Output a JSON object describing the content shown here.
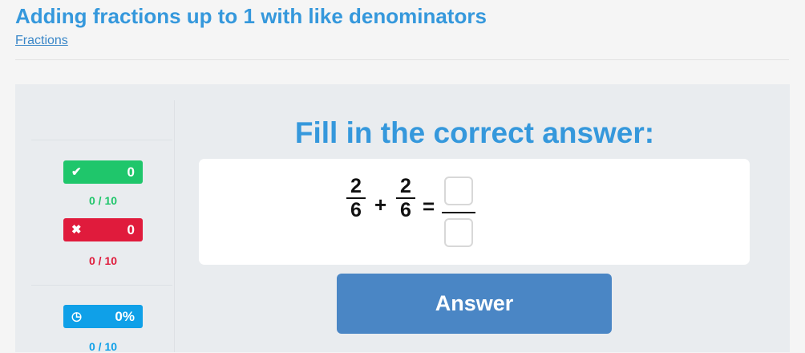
{
  "header": {
    "title": "Adding fractions up to 1 with like denominators",
    "breadcrumb": "Fractions"
  },
  "stats": {
    "correct": {
      "icon": "check-icon",
      "glyph": "✔",
      "count": "0",
      "progress": "0 / 10",
      "color": "#1fc66b"
    },
    "wrong": {
      "icon": "close-icon",
      "glyph": "✖",
      "count": "0",
      "progress": "0 / 10",
      "color": "#e01b3c"
    },
    "completion": {
      "icon": "clock-icon",
      "glyph": "◷",
      "percent": "0%",
      "progress": "0 / 10",
      "color": "#0fa0e8"
    }
  },
  "question": {
    "heading": "Fill in the correct answer:",
    "fraction1": {
      "numerator": "2",
      "denominator": "6"
    },
    "operator": "+",
    "fraction2": {
      "numerator": "2",
      "denominator": "6"
    },
    "equals": "="
  },
  "answer_button_label": "Answer"
}
